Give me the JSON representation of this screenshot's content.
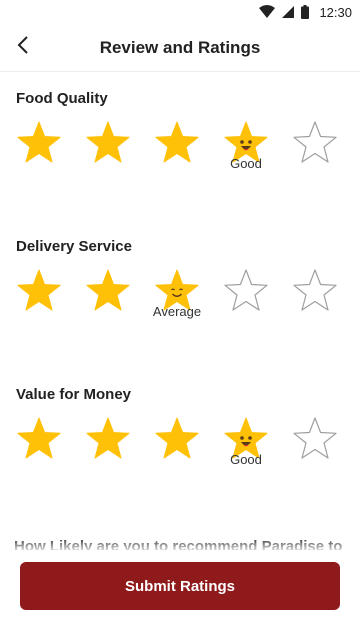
{
  "status_bar": {
    "time": "12:30",
    "icons": [
      "wifi-icon",
      "signal-icon",
      "battery-icon"
    ]
  },
  "header": {
    "title": "Review and Ratings",
    "back_icon": "back-arrow-icon"
  },
  "colors": {
    "star_filled": "#FFC107",
    "star_empty_outline": "#9e9e9e",
    "button_bg": "#8F1A1C",
    "face": "#5a3a1a",
    "tongue": "#e53935"
  },
  "sections": [
    {
      "title": "Food Quality",
      "rating": 4,
      "max": 5,
      "label": "Good",
      "face": "happy"
    },
    {
      "title": "Delivery Service",
      "rating": 3,
      "max": 5,
      "label": "Average",
      "face": "smile"
    },
    {
      "title": "Value for Money",
      "rating": 4,
      "max": 5,
      "label": "Good",
      "face": "happy"
    }
  ],
  "next_question": "How Likely are you to recommend Paradise to",
  "submit": {
    "label": "Submit Ratings"
  }
}
